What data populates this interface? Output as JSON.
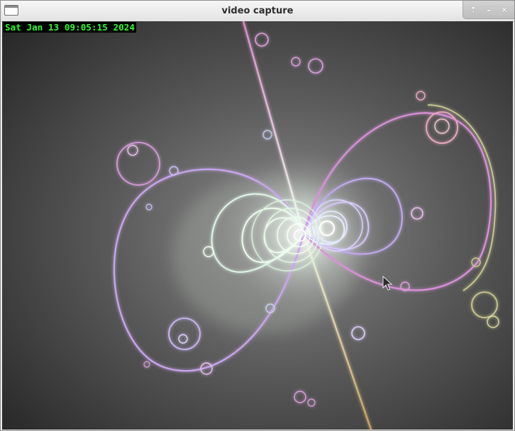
{
  "window": {
    "title": "video capture",
    "controls": {
      "shade_glyph": "⇡",
      "minimize_glyph": "–",
      "close_glyph": "✕"
    }
  },
  "overlay": {
    "timestamp": "Sat Jan 13 09:05:15 2024",
    "timestamp_color": "#2cff2c"
  },
  "icons": {
    "window_menu": "window-icon",
    "pointer": "mouse-pointer-icon"
  },
  "palette": {
    "background": "#3a3a3a",
    "glow_center": "#f4fff4",
    "glow_lilac": "#c6a6ec",
    "glow_pink": "#d68ad6",
    "glow_olive": "#c8c88c"
  }
}
